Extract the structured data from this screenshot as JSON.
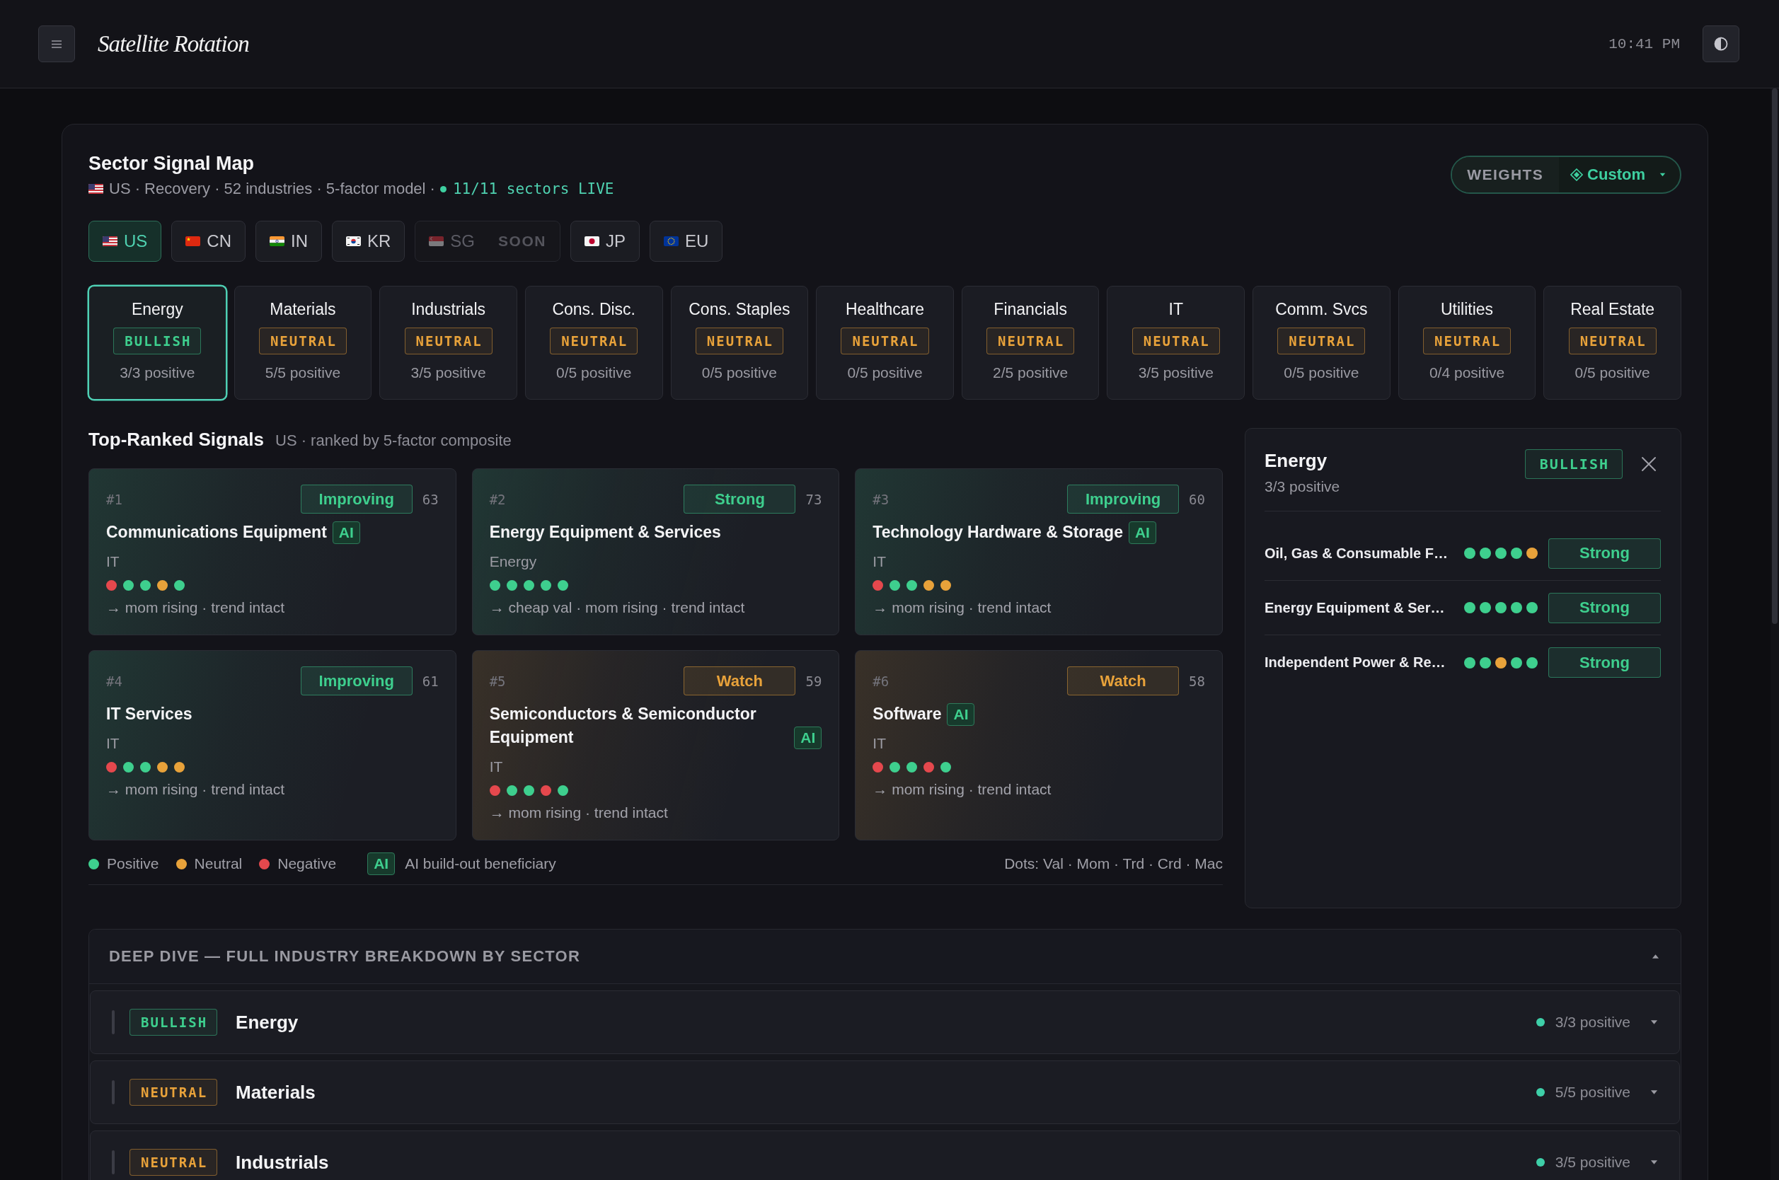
{
  "header": {
    "title": "Satellite Rotation",
    "time": "10:41 PM"
  },
  "map": {
    "title": "Sector Signal Map",
    "subtitle": {
      "text": "US · Recovery · 52 industries · 5-factor model ·",
      "live": "11/11 sectors LIVE"
    },
    "weights": {
      "label": "WEIGHTS",
      "value": "Custom"
    }
  },
  "countries": [
    {
      "kind": "us",
      "label": "US",
      "selected": true,
      "disabled": false
    },
    {
      "kind": "cn",
      "label": "CN",
      "selected": false,
      "disabled": false
    },
    {
      "kind": "in",
      "label": "IN",
      "selected": false,
      "disabled": false
    },
    {
      "kind": "kr",
      "label": "KR",
      "selected": false,
      "disabled": false
    },
    {
      "kind": "sg",
      "label": "SG",
      "selected": false,
      "disabled": true,
      "tag": "SOON"
    },
    {
      "kind": "jp",
      "label": "JP",
      "selected": false,
      "disabled": false
    },
    {
      "kind": "eu",
      "label": "EU",
      "selected": false,
      "disabled": false
    }
  ],
  "sectors": [
    {
      "name": "Energy",
      "stance": "BULLISH",
      "color": "#3ecf8e",
      "count": "3/3 positive",
      "selected": true
    },
    {
      "name": "Materials",
      "stance": "NEUTRAL",
      "color": "#e8a23a",
      "count": "5/5 positive",
      "selected": false
    },
    {
      "name": "Industrials",
      "stance": "NEUTRAL",
      "color": "#e8a23a",
      "count": "3/5 positive",
      "selected": false
    },
    {
      "name": "Cons. Disc.",
      "stance": "NEUTRAL",
      "color": "#e8a23a",
      "count": "0/5 positive",
      "selected": false
    },
    {
      "name": "Cons. Staples",
      "stance": "NEUTRAL",
      "color": "#e8a23a",
      "count": "0/5 positive",
      "selected": false
    },
    {
      "name": "Healthcare",
      "stance": "NEUTRAL",
      "color": "#e8a23a",
      "count": "0/5 positive",
      "selected": false
    },
    {
      "name": "Financials",
      "stance": "NEUTRAL",
      "color": "#e8a23a",
      "count": "2/5 positive",
      "selected": false
    },
    {
      "name": "IT",
      "stance": "NEUTRAL",
      "color": "#e8a23a",
      "count": "3/5 positive",
      "selected": false
    },
    {
      "name": "Comm. Svcs",
      "stance": "NEUTRAL",
      "color": "#e8a23a",
      "count": "0/5 positive",
      "selected": false
    },
    {
      "name": "Utilities",
      "stance": "NEUTRAL",
      "color": "#e8a23a",
      "count": "0/4 positive",
      "selected": false
    },
    {
      "name": "Real Estate",
      "stance": "NEUTRAL",
      "color": "#e8a23a",
      "count": "0/5 positive",
      "selected": false
    }
  ],
  "signals_header": {
    "title": "Top-Ranked Signals",
    "subtitle": "US · ranked by 5-factor composite"
  },
  "signals": [
    {
      "rank": "#1",
      "status": "Improving",
      "color": "#3ecf8e",
      "score": "63",
      "name": "Communications Equipment",
      "tag": "AI",
      "sector": "IT",
      "dots": [
        {
          "color": "#e5484d"
        },
        {
          "color": "#3ecf8e"
        },
        {
          "color": "#3ecf8e"
        },
        {
          "color": "#e8a23a"
        },
        {
          "color": "#3ecf8e"
        }
      ],
      "reason": "→ mom rising · trend intact"
    },
    {
      "rank": "#2",
      "status": "Strong",
      "color": "#3ecf8e",
      "score": "73",
      "name": "Energy Equipment & Services",
      "sector": "Energy",
      "dots": [
        {
          "color": "#3ecf8e"
        },
        {
          "color": "#3ecf8e"
        },
        {
          "color": "#3ecf8e"
        },
        {
          "color": "#3ecf8e"
        },
        {
          "color": "#3ecf8e"
        }
      ],
      "reason": "→ cheap val · mom rising · trend intact"
    },
    {
      "rank": "#3",
      "status": "Improving",
      "color": "#3ecf8e",
      "score": "60",
      "name": "Technology Hardware & Storage",
      "tag": "AI",
      "sector": "IT",
      "dots": [
        {
          "color": "#e5484d"
        },
        {
          "color": "#3ecf8e"
        },
        {
          "color": "#3ecf8e"
        },
        {
          "color": "#e8a23a"
        },
        {
          "color": "#e8a23a"
        }
      ],
      "reason": "→ mom rising · trend intact"
    },
    {
      "rank": "#4",
      "status": "Improving",
      "color": "#3ecf8e",
      "score": "61",
      "name": "IT Services",
      "sector": "IT",
      "dots": [
        {
          "color": "#e5484d"
        },
        {
          "color": "#3ecf8e"
        },
        {
          "color": "#3ecf8e"
        },
        {
          "color": "#e8a23a"
        },
        {
          "color": "#e8a23a"
        }
      ],
      "reason": "→ mom rising · trend intact"
    },
    {
      "rank": "#5",
      "status": "Watch",
      "color": "#e8a23a",
      "score": "59",
      "name": "Semiconductors & Semiconductor Equipment",
      "tag": "AI",
      "sector": "IT",
      "dots": [
        {
          "color": "#e5484d"
        },
        {
          "color": "#3ecf8e"
        },
        {
          "color": "#3ecf8e"
        },
        {
          "color": "#e5484d"
        },
        {
          "color": "#3ecf8e"
        }
      ],
      "reason": "→ mom rising · trend intact"
    },
    {
      "rank": "#6",
      "status": "Watch",
      "color": "#e8a23a",
      "score": "58",
      "name": "Software",
      "tag": "AI",
      "sector": "IT",
      "dots": [
        {
          "color": "#e5484d"
        },
        {
          "color": "#3ecf8e"
        },
        {
          "color": "#3ecf8e"
        },
        {
          "color": "#e5484d"
        },
        {
          "color": "#3ecf8e"
        }
      ],
      "reason": "→ mom rising · trend intact"
    }
  ],
  "legend": {
    "items": [
      {
        "label": "Positive",
        "color": "#3ecf8e"
      },
      {
        "label": "Neutral",
        "color": "#e8a23a"
      },
      {
        "label": "Negative",
        "color": "#e5484d"
      }
    ],
    "tag": "AI",
    "tag_label": "AI build-out beneficiary",
    "dots_key": "Dots: Val · Mom · Trd · Crd · Mac"
  },
  "detail": {
    "title": "Energy",
    "count": "3/3 positive",
    "stance": "BULLISH",
    "color": "#3ecf8e",
    "rows": [
      {
        "name": "Oil, Gas & Consumable F…",
        "dots": [
          {
            "color": "#3ecf8e"
          },
          {
            "color": "#3ecf8e"
          },
          {
            "color": "#3ecf8e"
          },
          {
            "color": "#3ecf8e"
          },
          {
            "color": "#e8a23a"
          }
        ],
        "status": "Strong",
        "color": "#3ecf8e"
      },
      {
        "name": "Energy Equipment & Ser…",
        "dots": [
          {
            "color": "#3ecf8e"
          },
          {
            "color": "#3ecf8e"
          },
          {
            "color": "#3ecf8e"
          },
          {
            "color": "#3ecf8e"
          },
          {
            "color": "#3ecf8e"
          }
        ],
        "status": "Strong",
        "color": "#3ecf8e"
      },
      {
        "name": "Independent Power & Re…",
        "dots": [
          {
            "color": "#3ecf8e"
          },
          {
            "color": "#3ecf8e"
          },
          {
            "color": "#e8a23a"
          },
          {
            "color": "#3ecf8e"
          },
          {
            "color": "#3ecf8e"
          }
        ],
        "status": "Strong",
        "color": "#3ecf8e"
      }
    ]
  },
  "deep_dive": {
    "title": "DEEP DIVE — FULL INDUSTRY BREAKDOWN BY SECTOR",
    "expanded": true,
    "rows": [
      {
        "stance": "BULLISH",
        "color": "#3ecf8e",
        "name": "Energy",
        "count": "3/3 positive",
        "expanded": false
      },
      {
        "stance": "NEUTRAL",
        "color": "#e8a23a",
        "name": "Materials",
        "count": "5/5 positive",
        "expanded": false
      },
      {
        "stance": "NEUTRAL",
        "color": "#e8a23a",
        "name": "Industrials",
        "count": "3/5 positive",
        "expanded": false
      }
    ]
  }
}
